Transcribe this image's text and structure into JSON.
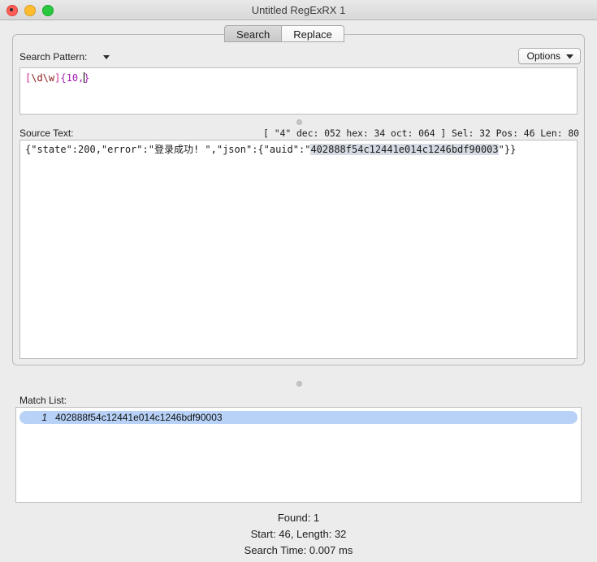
{
  "window": {
    "title": "Untitled RegExRX 1",
    "controls": [
      {
        "name": "close",
        "color": "#ff5f57"
      },
      {
        "name": "minimize",
        "color": "#febc2e"
      },
      {
        "name": "zoom",
        "color": "#28c840"
      }
    ]
  },
  "tabs": [
    {
      "label": "Search",
      "active": true
    },
    {
      "label": "Replace",
      "active": false
    }
  ],
  "search_pattern": {
    "label": "Search Pattern:",
    "disclosure_icon": "triangle-down-icon",
    "value": "[\\d\\w]{10,}",
    "tokens": [
      {
        "text": "[",
        "kind": "class"
      },
      {
        "text": "\\d\\w",
        "kind": "escape"
      },
      {
        "text": "]",
        "kind": "class"
      },
      {
        "text": "{10,",
        "kind": "quant"
      },
      {
        "text": "}",
        "kind": "quant"
      }
    ]
  },
  "options_button": {
    "label": "Options",
    "icon": "chevron-down-icon"
  },
  "source_text": {
    "label": "Source Text:",
    "char_info": "[ \"4\" dec: 052 hex: 34 oct: 064 ] Sel: 32 Pos: 46 Len: 80",
    "prefix": "{\"state\":200,\"error\":\"登录成功! \",\"json\":{\"auid\":\"",
    "selection": "402888f54c12441e014c1246bdf90003",
    "suffix": "\"}}",
    "full_value": "{\"state\":200,\"error\":\"登录成功! \",\"json\":{\"auid\":\"402888f54c12441e014c1246bdf90003\"}}"
  },
  "match_list": {
    "label": "Match List:",
    "rows": [
      {
        "index": "1",
        "value": "402888f54c12441e014c1246bdf90003",
        "selected": true
      }
    ]
  },
  "footer": {
    "found": "Found: 1",
    "range": "Start: 46, Length: 32",
    "time": "Search Time: 0.007 ms"
  },
  "colors": {
    "window_bg": "#ececec",
    "selection_blue": "#b8d2f7",
    "text_selection": "#d5dbe3",
    "regex_class": "#cf2d8f",
    "regex_escape": "#8a1c1c",
    "regex_quant": "#a020b0"
  }
}
